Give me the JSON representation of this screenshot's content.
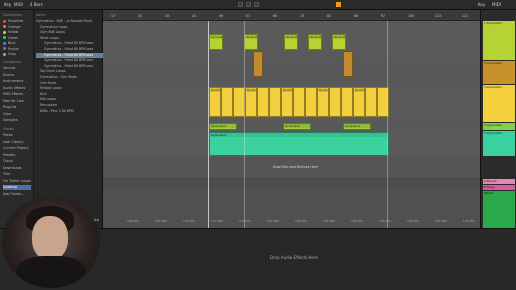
{
  "top_bar": {
    "left_items": [
      "Key",
      "MIDI",
      "4 Bars"
    ],
    "right_items": [
      "Key",
      "MIDI"
    ]
  },
  "sidebar": {
    "collections_header": "Collections",
    "collections": [
      {
        "label": "Favorites",
        "color": "#e74c3c"
      },
      {
        "label": "Orange",
        "color": "#e67e22"
      },
      {
        "label": "Yellow",
        "color": "#f1c40f"
      },
      {
        "label": "Green",
        "color": "#2ecc71"
      },
      {
        "label": "Blue",
        "color": "#3498db"
      },
      {
        "label": "Purple",
        "color": "#9b59b6"
      },
      {
        "label": "Gray",
        "color": "#95a5a6"
      }
    ],
    "categories_header": "Categories",
    "categories": [
      "Sounds",
      "Drums",
      "Instruments",
      "Audio Effects",
      "MIDI Effects",
      "Max for Live",
      "Plug-Ins",
      "Clips",
      "Samples"
    ],
    "places_header": "Places",
    "places": [
      "Packs",
      "User Library",
      "Current Project",
      "Presets",
      "Cloud",
      "Downloads",
      "Trim",
      "For Trailer Loops",
      "Desktop",
      "Add Folder..."
    ],
    "files_header": "Name",
    "files": [
      "Gymnatica - 808 ...(s Sample Pack)",
      "Gymnatica Loops",
      "Gym 808 Loops",
      "Hihat Loops",
      "Gymnatica - Hihat 80 BPM.wav",
      "Gymnatica - Hihat 80 BPM.wav",
      "Gymnatica - Hihat 80 BPM.wav",
      "Gymnatica - Hihat 80 BPM.wav",
      "Gymnatica - Hihat 80 BPM.wav",
      "Top Drum Loops",
      "Gymnatica - One Shots",
      "One Shots",
      "Melody Loops",
      "Kick",
      "Mix Loops",
      "Percussion",
      "808s - Perc 2 80 BPM"
    ],
    "footer": "Raw"
  },
  "ruler": {
    "bars": [
      "17",
      "25",
      "33",
      "41",
      "49",
      "57",
      "65",
      "73",
      "81",
      "89",
      "97",
      "105",
      "113",
      "121"
    ]
  },
  "arrangement": {
    "drop_hint": "Drop Files and Devices Here",
    "time_labels": [
      "0:00:000",
      "0:05:000",
      "0:10:000",
      "0:15:000",
      "0:20:000",
      "0:25:000",
      "0:30:000",
      "0:35:000",
      "0:40:000",
      "0:45:000",
      "0:50:000",
      "0:55:000",
      "1:00:000"
    ],
    "clip_label": "Gymnatica"
  },
  "tracks": [
    {
      "label": "1 Gymnatica",
      "color": "#b5d334"
    },
    {
      "label": "2 Gymnatica",
      "color": "#c8922a"
    },
    {
      "label": "3 Gymnatica",
      "color": "#f4d03f"
    },
    {
      "label": "4 Gymnatica",
      "color": "#7fd14a"
    },
    {
      "label": "5 Gymnatica",
      "color": "#3ad0a0"
    },
    {
      "label": "A Reverb",
      "color": "#e784b8"
    },
    {
      "label": "B Delay",
      "color": "#d45fa0"
    },
    {
      "label": "Master",
      "color": "#2aa84a"
    }
  ],
  "bottom": {
    "drop_hint": "Drop Audio Effects Here"
  }
}
